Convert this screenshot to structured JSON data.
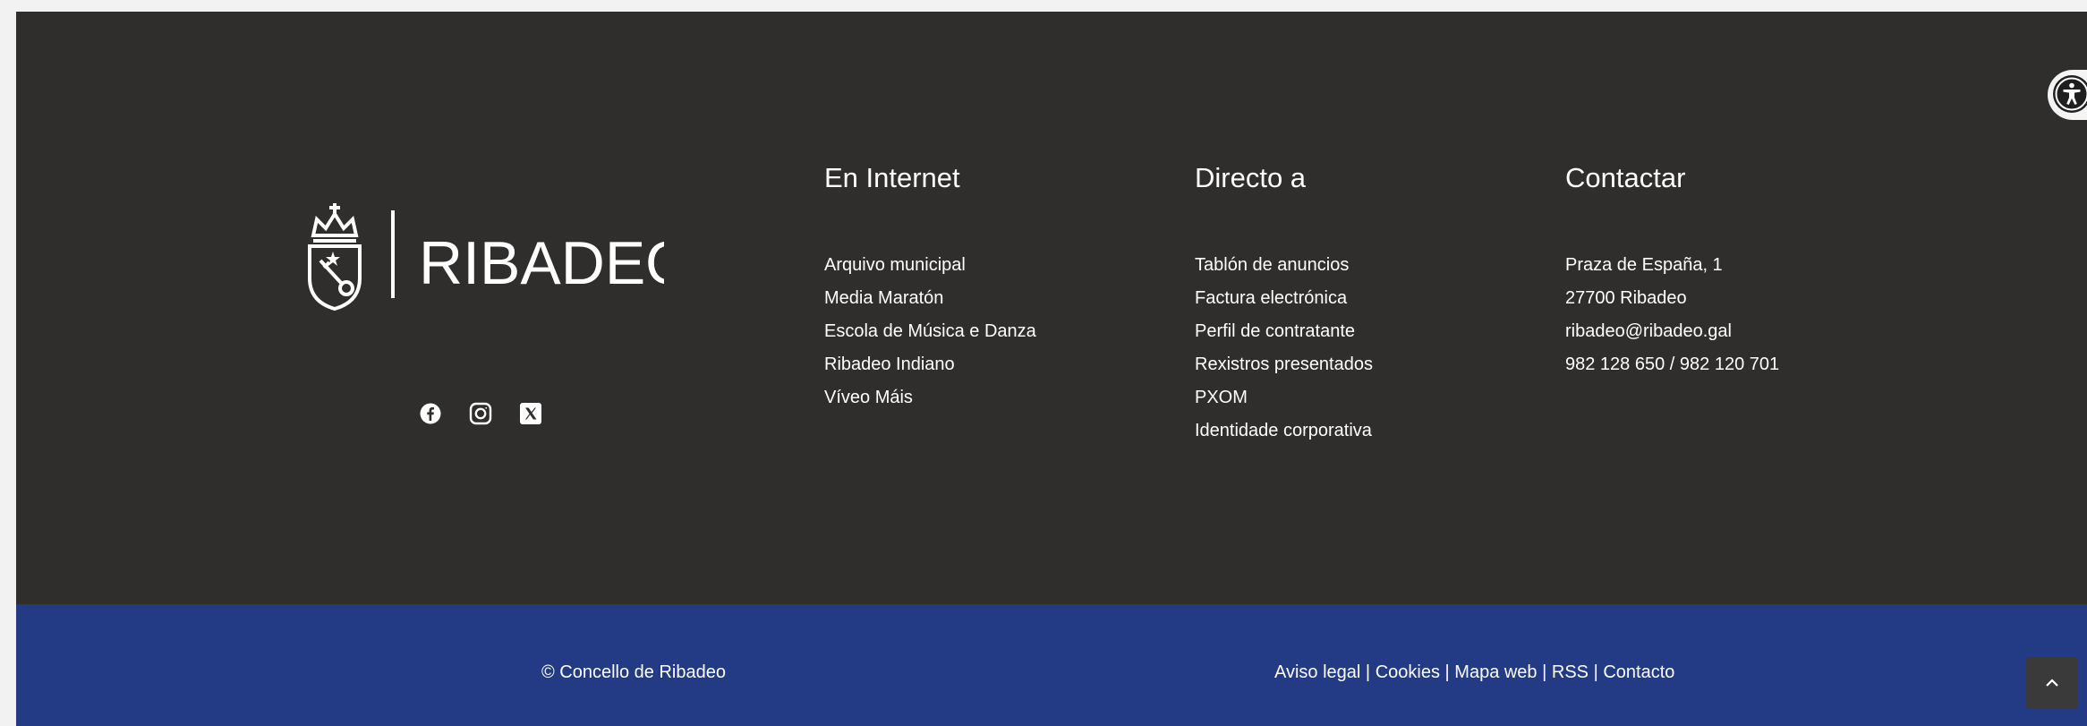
{
  "brand": {
    "name": "RIBADEO"
  },
  "social": [
    {
      "icon": "facebook-icon"
    },
    {
      "icon": "instagram-icon"
    },
    {
      "icon": "x-twitter-icon"
    }
  ],
  "columns": {
    "internet": {
      "title": "En Internet",
      "items": [
        "Arquivo municipal",
        "Media Maratón",
        "Escola de Música e Danza",
        "Ribadeo Indiano",
        "Víveo Máis"
      ]
    },
    "directo": {
      "title": "Directo a",
      "items": [
        "Tablón de anuncios",
        "Factura electrónica",
        "Perfil de contratante",
        "Rexistros presentados",
        "PXOM",
        "Identidade corporativa"
      ]
    },
    "contactar": {
      "title": "Contactar",
      "items": [
        "Praza de España, 1",
        "27700 Ribadeo",
        "ribadeo@ribadeo.gal",
        "982 128 650 / 982 120 701"
      ]
    }
  },
  "bottom": {
    "copyright": "© Concello de Ribadeo",
    "links": [
      "Aviso legal",
      "Cookies",
      "Mapa web",
      "RSS",
      "Contacto"
    ],
    "separator": "|"
  },
  "widgets": {
    "accessibility_icon": "accessibility-icon",
    "back_to_top_icon": "chevron-up-icon"
  },
  "colors": {
    "footer_bg": "#2f2e2d",
    "bottom_bar_bg": "#233a85",
    "text": "#ffffff"
  }
}
